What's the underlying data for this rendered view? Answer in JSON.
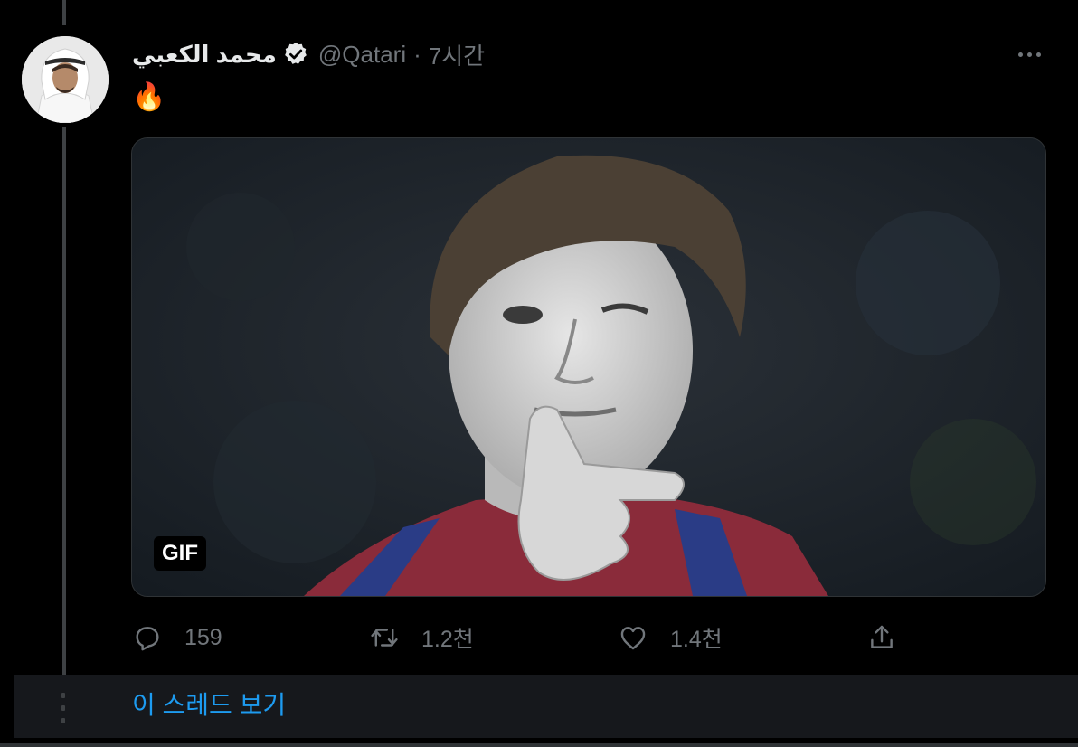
{
  "author": {
    "display_name": "محمد الكعبي",
    "handle": "@Qatari",
    "separator": "·",
    "time": "7시간",
    "verified": true
  },
  "tweet": {
    "text": "🔥"
  },
  "media": {
    "badge": "GIF"
  },
  "actions": {
    "reply_count": "159",
    "retweet_count": "1.2천",
    "like_count": "1.4천"
  },
  "thread": {
    "show_thread_label": "이 스레드 보기"
  },
  "colors": {
    "background": "#000000",
    "text_primary": "#e7e9ea",
    "text_secondary": "#71767b",
    "accent": "#1d9bf0",
    "thread_bar": "#16181c"
  },
  "icons": [
    "verified-badge-icon",
    "more-icon",
    "reply-icon",
    "retweet-icon",
    "like-icon",
    "share-icon"
  ]
}
